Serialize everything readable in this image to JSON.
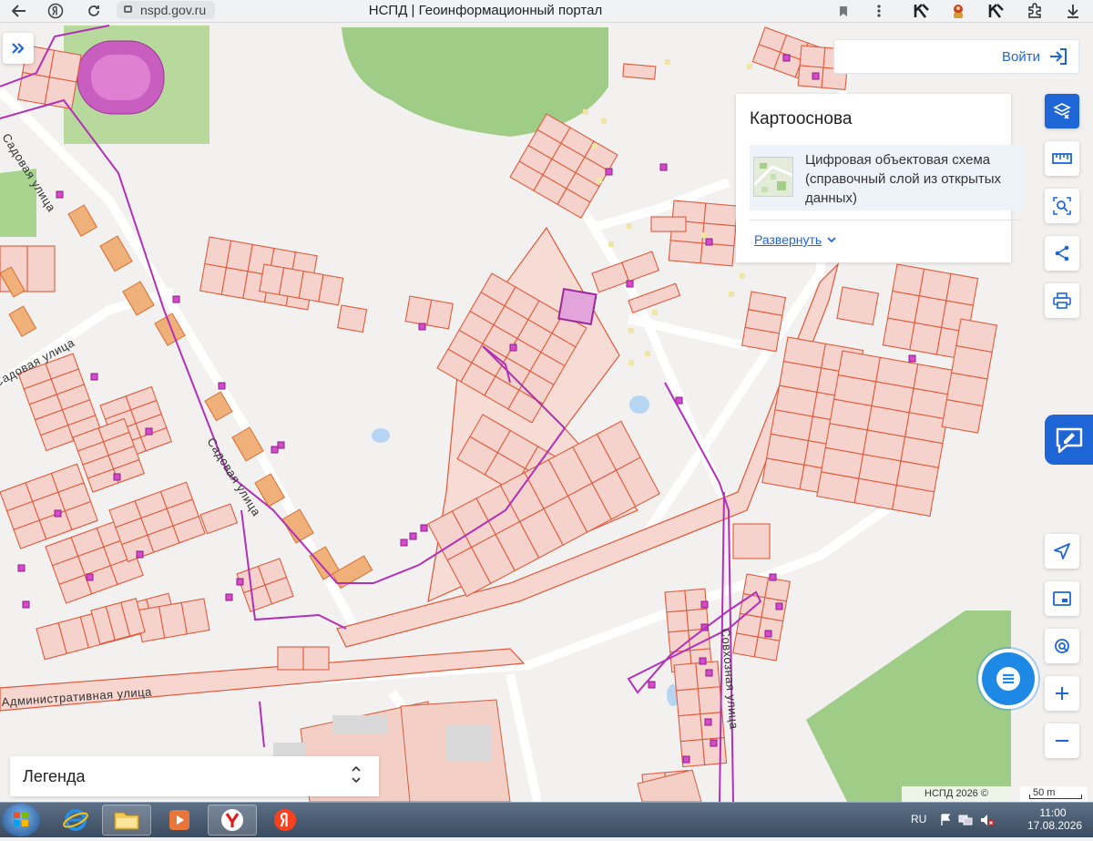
{
  "browser": {
    "url": "nspd.gov.ru",
    "page_title": "НСПД | Геоинформационный портал",
    "back_icon": "arrow-left-icon",
    "yandex_icon": "yandex-icon",
    "reload_icon": "reload-icon",
    "bookmark_icon": "bookmark-icon",
    "menu_icon": "kebab-menu-icon",
    "download_icon": "download-icon"
  },
  "header": {
    "login_label": "Войти",
    "login_icon": "sign-in-icon"
  },
  "layers_panel": {
    "title": "Картооснова",
    "layer_name": "Цифровая объектовая схема (справочный слой из открытых данных)",
    "expand_label": "Развернуть"
  },
  "map": {
    "street_labels": [
      "Садовая улица",
      "Садовая улица",
      "Садовая улица",
      "Административная улица",
      "Совхозная улица"
    ],
    "copyright": "НСПД 2026 ©",
    "scale_label": "50 m"
  },
  "legend": {
    "label": "Легенда"
  },
  "toolbar": {
    "buttons": [
      "layers-icon",
      "ruler-icon",
      "search-area-icon",
      "share-icon",
      "print-icon"
    ],
    "lower_buttons": [
      "navigate-icon",
      "map-switch-icon",
      "geolocation-icon",
      "zoom-in-icon",
      "zoom-out-icon"
    ]
  },
  "taskbar": {
    "language": "RU",
    "time": "11:00",
    "date": "17.08.2026"
  },
  "colors": {
    "accent": "#1e66d6",
    "parcel_fill": "#f5d3cc",
    "parcel_stroke": "#e15a3c",
    "boundary": "#b130b8",
    "green": "#8fc773"
  }
}
